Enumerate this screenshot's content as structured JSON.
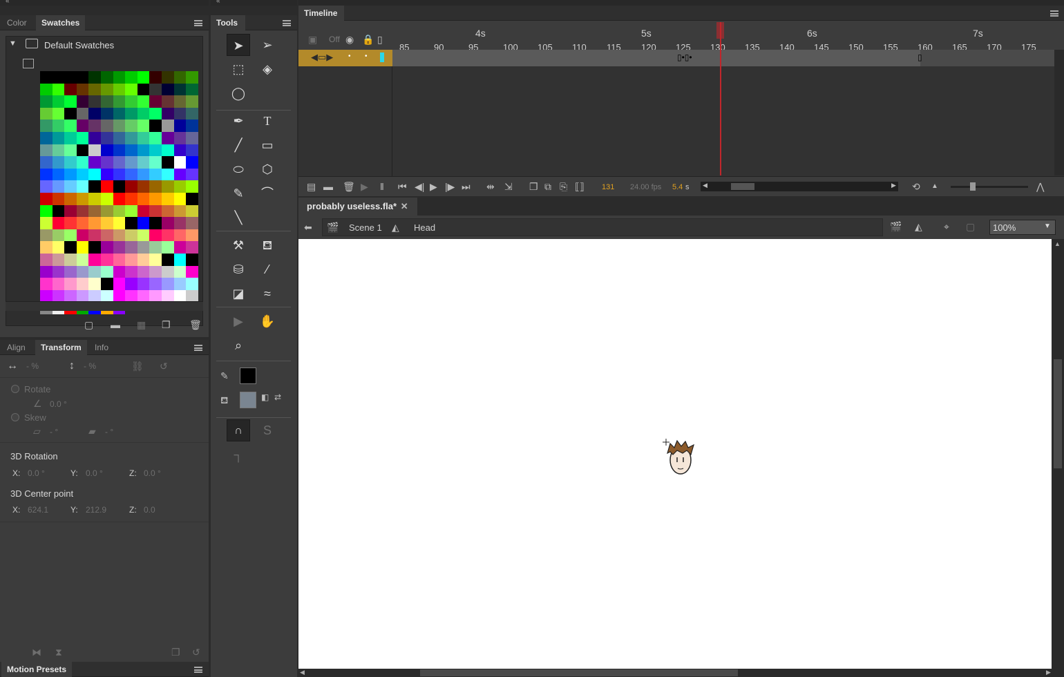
{
  "left_panels": {
    "color_tabs": {
      "color": "Color",
      "swatches": "Swatches"
    },
    "swatches": {
      "folder_label": "Default Swatches",
      "palette": [
        "#000000",
        "#000000",
        "#000000",
        "#000000",
        "#003300",
        "#006600",
        "#009900",
        "#00CC00",
        "#00FF00",
        "#330000",
        "#333300",
        "#336600",
        "#339900",
        "#00CC00",
        "#33FF00",
        "#660000",
        "#663300",
        "#666600",
        "#669900",
        "#66CC00",
        "#66FF00",
        "#000000",
        "#333333",
        "#000033",
        "#003333",
        "#006633",
        "#009933",
        "#00CC33",
        "#00FF33",
        "#330033",
        "#333333",
        "#336633",
        "#339933",
        "#33CC33",
        "#33FF33",
        "#660033",
        "#663333",
        "#666633",
        "#669933",
        "#66CC33",
        "#66FF33",
        "#000000",
        "#666666",
        "#000066",
        "#003366",
        "#006666",
        "#009966",
        "#00CC66",
        "#00FF66",
        "#330066",
        "#333366",
        "#336666",
        "#339966",
        "#33CC66",
        "#33FF66",
        "#660066",
        "#663366",
        "#666666",
        "#669966",
        "#66CC66",
        "#66FF66",
        "#000000",
        "#999999",
        "#000099",
        "#003399",
        "#006699",
        "#009999",
        "#00CC99",
        "#00FF99",
        "#330099",
        "#333399",
        "#336699",
        "#339999",
        "#33CC99",
        "#33FF99",
        "#660099",
        "#663399",
        "#666699",
        "#669999",
        "#66CC99",
        "#66FF99",
        "#000000",
        "#CCCCCC",
        "#0000CC",
        "#0033CC",
        "#0066CC",
        "#0099CC",
        "#00CCCC",
        "#00FFCC",
        "#3300CC",
        "#3333CC",
        "#3366CC",
        "#3399CC",
        "#33CCCC",
        "#33FFCC",
        "#6600CC",
        "#6633CC",
        "#6666CC",
        "#6699CC",
        "#66CCCC",
        "#66FFCC",
        "#000000",
        "#FFFFFF",
        "#0000FF",
        "#0033FF",
        "#0066FF",
        "#0099FF",
        "#00CCFF",
        "#00FFFF",
        "#3300FF",
        "#3333FF",
        "#3366FF",
        "#3399FF",
        "#33CCFF",
        "#33FFFF",
        "#6600FF",
        "#6633FF",
        "#6666FF",
        "#6699FF",
        "#66CCFF",
        "#66FFFF",
        "#000000",
        "#FF0000",
        "#000000",
        "#990000",
        "#993300",
        "#996600",
        "#999900",
        "#99CC00",
        "#99FF00",
        "#CC0000",
        "#CC3300",
        "#CC6600",
        "#CC9900",
        "#CCCC00",
        "#CCFF00",
        "#FF0000",
        "#FF3300",
        "#FF6600",
        "#FF9900",
        "#FFCC00",
        "#FFFF00",
        "#000000",
        "#00FF00",
        "#000000",
        "#990033",
        "#993333",
        "#996633",
        "#999933",
        "#99CC33",
        "#99FF33",
        "#CC0033",
        "#CC3333",
        "#CC6633",
        "#CC9933",
        "#CCCC33",
        "#CCFF33",
        "#FF0033",
        "#FF3333",
        "#FF6633",
        "#FF9933",
        "#FFCC33",
        "#FFFF33",
        "#000000",
        "#0000FF",
        "#000000",
        "#990066",
        "#993366",
        "#996666",
        "#999966",
        "#99CC66",
        "#99FF66",
        "#CC0066",
        "#CC3366",
        "#CC6666",
        "#CC9966",
        "#CCCC66",
        "#CCFF66",
        "#FF0066",
        "#FF3366",
        "#FF6666",
        "#FF9966",
        "#FFCC66",
        "#FFFF66",
        "#000000",
        "#FFFF00",
        "#000000",
        "#990099",
        "#993399",
        "#996699",
        "#999999",
        "#99CC99",
        "#99FF99",
        "#CC0099",
        "#CC3399",
        "#CC6699",
        "#CC9999",
        "#CCCC99",
        "#CCFF99",
        "#FF0099",
        "#FF3399",
        "#FF6699",
        "#FF9999",
        "#FFCC99",
        "#FFFF99",
        "#000000",
        "#00FFFF",
        "#000000",
        "#9900CC",
        "#9933CC",
        "#9966CC",
        "#9999CC",
        "#99CCCC",
        "#99FFCC",
        "#CC00CC",
        "#CC33CC",
        "#CC66CC",
        "#CC99CC",
        "#CCCCCC",
        "#CCFFCC",
        "#FF00CC",
        "#FF33CC",
        "#FF66CC",
        "#FF99CC",
        "#FFCCCC",
        "#FFFFCC",
        "#000000",
        "#FF00FF",
        "#9900FF",
        "#9933FF",
        "#9966FF",
        "#9999FF",
        "#99CCFF",
        "#99FFFF",
        "#CC00FF",
        "#CC33FF",
        "#CC66FF",
        "#CC99FF",
        "#CCCCFF",
        "#CCFFFF",
        "#FF00FF",
        "#FF33FF",
        "#FF66FF",
        "#FF99FF",
        "#FFCCFF",
        "#FFFFFF",
        "#CCCCCC",
        "#888888",
        "#EEEEEE",
        "#FF0000",
        "#00AA00",
        "#0000FF",
        "#FFAA00",
        "#8800FF"
      ]
    },
    "transform_tabs": {
      "align": "Align",
      "transform": "Transform",
      "info": "Info"
    },
    "transform": {
      "width_value": "- %",
      "height_value": "- %",
      "rotate_label": "Rotate",
      "rotate_value": "0.0 °",
      "skew_label": "Skew",
      "skew_h_value": "- °",
      "skew_v_value": "- °",
      "rotation3d_label": "3D Rotation",
      "rot_x_label": "X:",
      "rot_x_value": "0.0 °",
      "rot_y_label": "Y:",
      "rot_y_value": "0.0 °",
      "rot_z_label": "Z:",
      "rot_z_value": "0.0 °",
      "center3d_label": "3D Center point",
      "c_x_label": "X:",
      "c_x_value": "624.1",
      "c_y_label": "Y:",
      "c_y_value": "212.9",
      "c_z_label": "Z:",
      "c_z_value": "0.0"
    },
    "motion_presets": "Motion Presets"
  },
  "tools_panel": {
    "title": "Tools"
  },
  "timeline": {
    "title": "Timeline",
    "off_label": "Off",
    "seconds": [
      "4s",
      "5s",
      "6s",
      "7s"
    ],
    "frames": [
      "85",
      "90",
      "95",
      "100",
      "105",
      "110",
      "115",
      "120",
      "125",
      "130",
      "135",
      "140",
      "145",
      "150",
      "155",
      "160",
      "165",
      "170",
      "175"
    ],
    "current_frame": "131",
    "fps": "24.00 fps",
    "time": "5.4",
    "time_unit": "s",
    "playhead_frame": 130
  },
  "document": {
    "tab_title": "probably useless.fla*",
    "scene_label": "Scene 1",
    "symbol_label": "Head",
    "zoom": "100%"
  },
  "colors": {
    "accent": "#b38a2a",
    "playhead": "#c0262b",
    "stroke_color": "#000000",
    "fill_color": "#7a8591"
  }
}
